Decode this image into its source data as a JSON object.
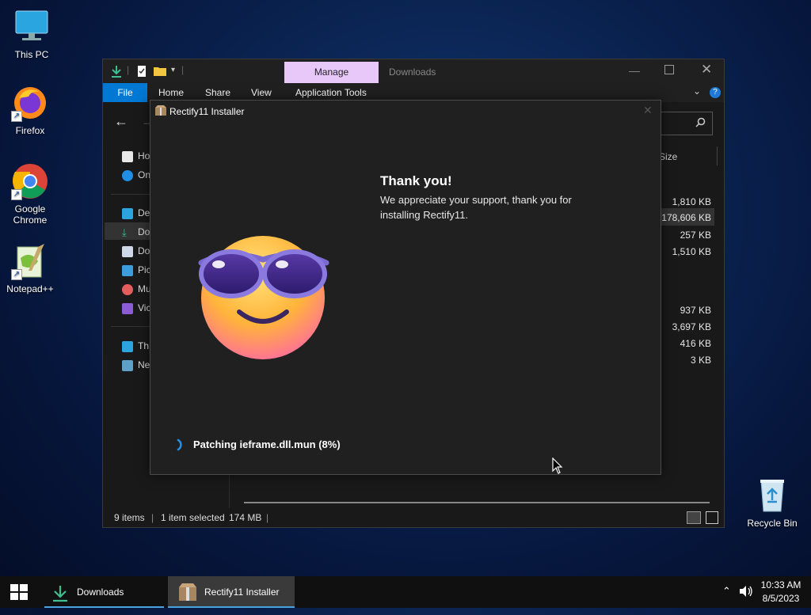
{
  "desktop": {
    "icons": [
      {
        "label": "This PC"
      },
      {
        "label": "Firefox"
      },
      {
        "label": "Google Chrome"
      },
      {
        "label": "Notepad++"
      },
      {
        "label": "Recycle Bin"
      }
    ]
  },
  "explorer": {
    "context_tab": "Manage",
    "window_title": "Downloads",
    "ribbon_tabs": [
      "File",
      "Home",
      "Share",
      "View",
      "Application Tools"
    ],
    "column_size_header": "Size",
    "sidebar": [
      "Ho",
      "On",
      "De",
      "Do",
      "Do",
      "Pic",
      "Mu",
      "Vic",
      "Th",
      "Ne"
    ],
    "sizes": [
      "1,810 KB",
      "178,606 KB",
      "257 KB",
      "1,510 KB",
      "937 KB",
      "3,697 KB",
      "416 KB",
      "3 KB"
    ],
    "status": {
      "items": "9 items",
      "selected": "1 item selected",
      "size": "174 MB"
    }
  },
  "installer": {
    "title": "Rectify11 Installer",
    "heading": "Thank you!",
    "message_line1": "We appreciate your support, thank you for",
    "message_line2": "installing Rectify11.",
    "progress_text": "Patching ieframe.dll.mun (8%)",
    "progress_percent": 8
  },
  "taskbar": {
    "apps": [
      {
        "label": "Downloads"
      },
      {
        "label": "Rectify11 Installer"
      }
    ],
    "time": "10:33 AM",
    "date": "8/5/2023"
  },
  "colors": {
    "accent": "#0078d4",
    "manage_tab": "#e8c8f8",
    "explorer_bg": "#191919",
    "installer_bg": "#202020"
  }
}
